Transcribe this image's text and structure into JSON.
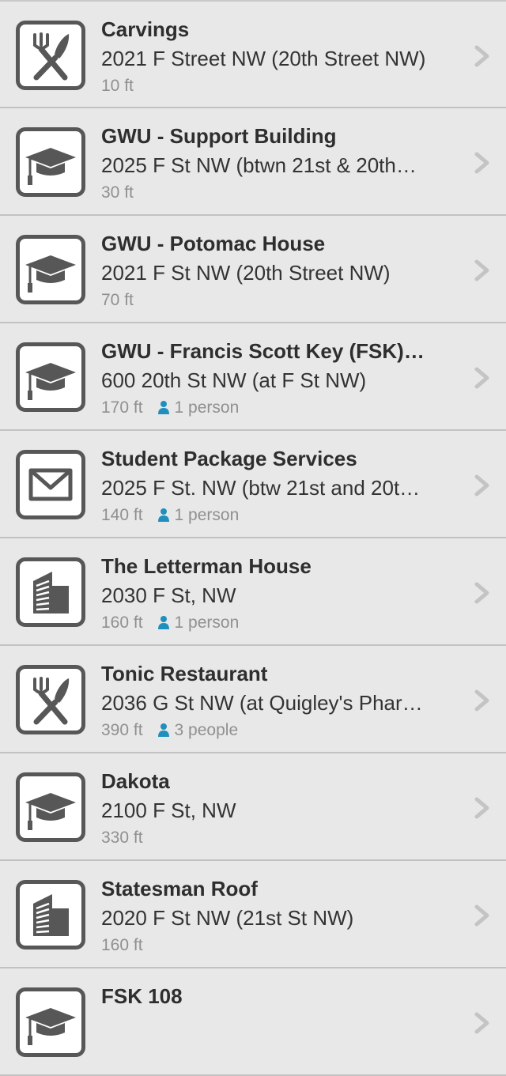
{
  "colors": {
    "row_background": "#e8e8e8",
    "icon_stroke": "#575757",
    "title_text": "#2e2e2e",
    "meta_text": "#909090",
    "person_icon": "#1f8fbd",
    "chevron": "#c4c4c4"
  },
  "places": [
    {
      "name": "Carvings",
      "address": "2021 F Street NW (20th Street NW)",
      "distance": "10 ft",
      "people": "",
      "icon": "fork-knife-icon"
    },
    {
      "name": "GWU - Support Building",
      "address": "2025 F St NW (btwn 21st & 20th…",
      "distance": "30 ft",
      "people": "",
      "icon": "graduation-cap-icon"
    },
    {
      "name": "GWU - Potomac House",
      "address": "2021 F St NW (20th Street NW)",
      "distance": "70 ft",
      "people": "",
      "icon": "graduation-cap-icon"
    },
    {
      "name": "GWU - Francis Scott Key (FSK)…",
      "address": "600 20th St NW (at F St NW)",
      "distance": "170 ft",
      "people": "1 person",
      "icon": "graduation-cap-icon"
    },
    {
      "name": "Student Package Services",
      "address": "2025 F St. NW (btw 21st and 20t…",
      "distance": "140 ft",
      "people": "1 person",
      "icon": "envelope-icon"
    },
    {
      "name": "The Letterman House",
      "address": "2030 F St, NW",
      "distance": "160 ft",
      "people": "1 person",
      "icon": "building-icon"
    },
    {
      "name": "Tonic Restaurant",
      "address": "2036 G St NW (at Quigley's Phar…",
      "distance": "390 ft",
      "people": "3 people",
      "icon": "fork-knife-icon"
    },
    {
      "name": "Dakota",
      "address": "2100 F St, NW",
      "distance": "330 ft",
      "people": "",
      "icon": "graduation-cap-icon"
    },
    {
      "name": "Statesman Roof",
      "address": "2020 F St NW (21st St NW)",
      "distance": "160 ft",
      "people": "",
      "icon": "building-icon"
    },
    {
      "name": "FSK 108",
      "address": "",
      "distance": "",
      "people": "",
      "icon": "graduation-cap-icon"
    }
  ]
}
